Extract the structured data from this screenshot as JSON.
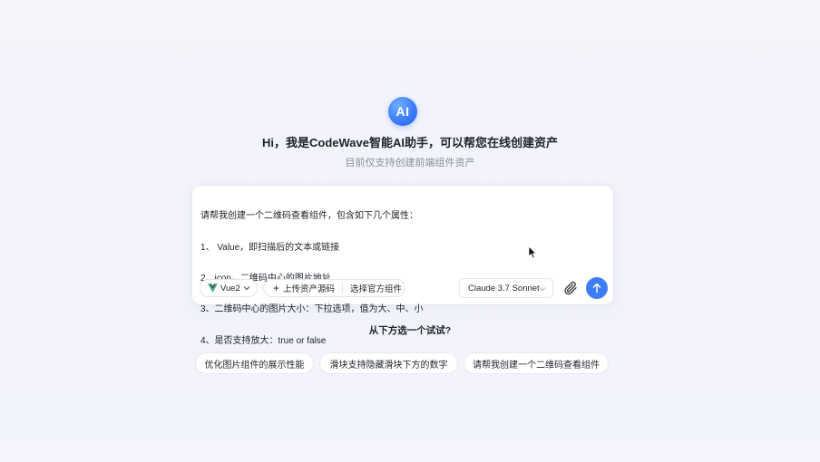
{
  "header": {
    "logo_text": "AI",
    "title": "Hi，我是CodeWave智能AI助手，可以帮您在线创建资产",
    "subtitle": "目前仅支持创建前端组件资产"
  },
  "prompt": {
    "lines": [
      "请帮我创建一个二维码查看组件，包含如下几个属性：",
      "1、 Value，即扫描后的文本或链接",
      "2、icon，二维码中心的图片地址",
      "3、二维码中心的图片大小：下拉选项，值为大、中、小",
      "4、是否支持放大：true or false"
    ]
  },
  "toolbar": {
    "framework_label": "Vue2",
    "upload_label": "上传资产源码",
    "official_label": "选择官方组件",
    "model_label": "Claude 3.7 Sonnet"
  },
  "suggestions": {
    "title": "从下方选一个试试?",
    "items": [
      "优化图片组件的展示性能",
      "滑块支持隐藏滑块下方的数字",
      "请帮我创建一个二维码查看组件"
    ]
  },
  "icons": {
    "logo": "ai-logo-icon",
    "vue": "vue-logo-icon",
    "plus": "plus-icon",
    "attach": "paperclip-icon",
    "send": "arrow-up-icon",
    "chevron": "chevron-down-icon"
  },
  "colors": {
    "accent": "#3f7cf7",
    "vue_green": "#41b883",
    "vue_dark": "#35495e"
  }
}
